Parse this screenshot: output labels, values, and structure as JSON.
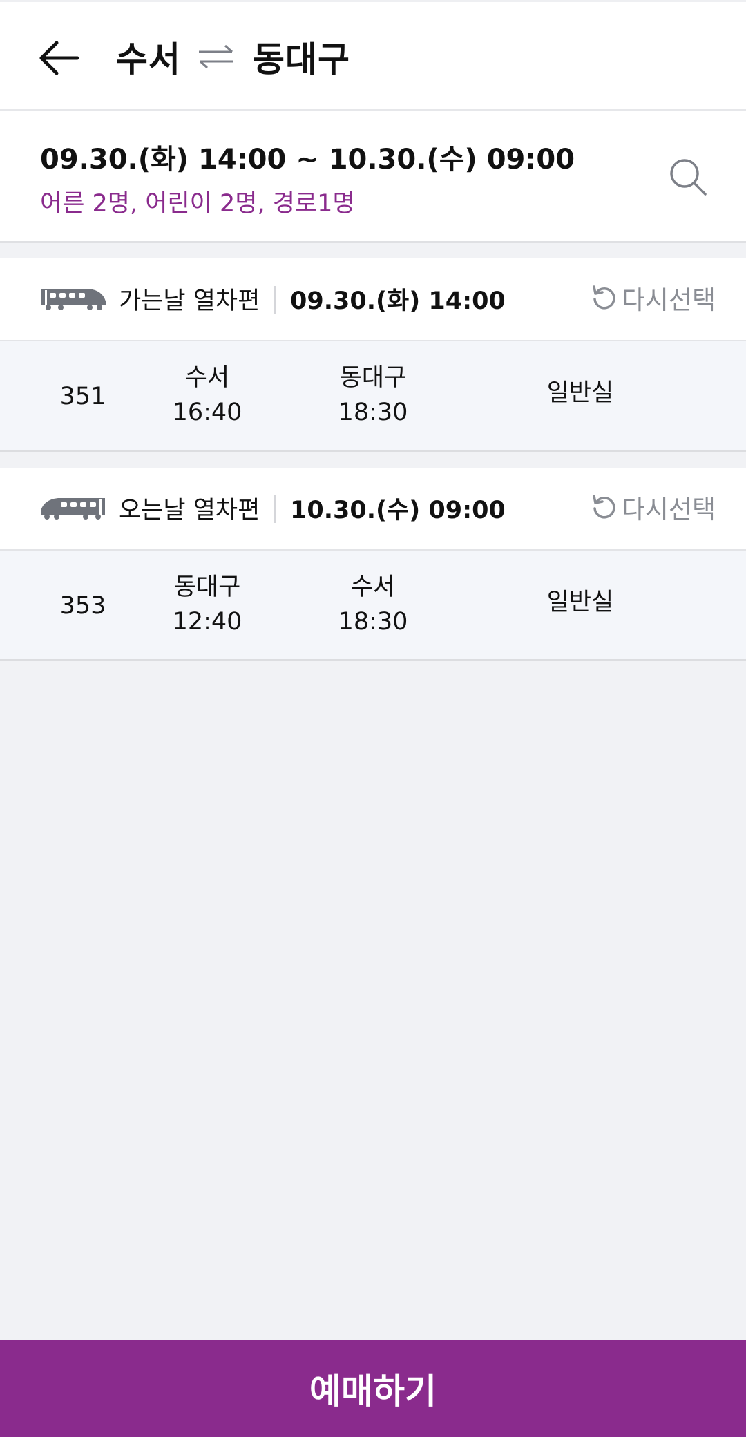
{
  "header": {
    "origin": "수서",
    "destination": "동대구"
  },
  "search": {
    "dates": "09.30.(화) 14:00 ~ 10.30.(수) 09:00",
    "passengers": "어른 2명, 어린이 2명, 경로1명"
  },
  "outbound": {
    "title": "가는날 열차편",
    "datetime": "09.30.(화) 14:00",
    "reselect_label": "다시선택",
    "train_no": "351",
    "dep_station": "수서",
    "dep_time": "16:40",
    "arr_station": "동대구",
    "arr_time": "18:30",
    "seat_class": "일반실"
  },
  "inbound": {
    "title": "오는날 열차편",
    "datetime": "10.30.(수) 09:00",
    "reselect_label": "다시선택",
    "train_no": "353",
    "dep_station": "동대구",
    "dep_time": "12:40",
    "arr_station": "수서",
    "arr_time": "18:30",
    "seat_class": "일반실"
  },
  "footer": {
    "book_label": "예매하기"
  },
  "colors": {
    "brand": "#8a2b8d",
    "icon_gray": "#6f737b",
    "background": "#f1f2f5"
  },
  "icons": {
    "back": "arrow-left-icon",
    "swap": "swap-arrows-icon",
    "search": "search-icon",
    "train_outbound": "train-icon",
    "train_inbound": "train-icon",
    "reselect": "refresh-icon"
  }
}
